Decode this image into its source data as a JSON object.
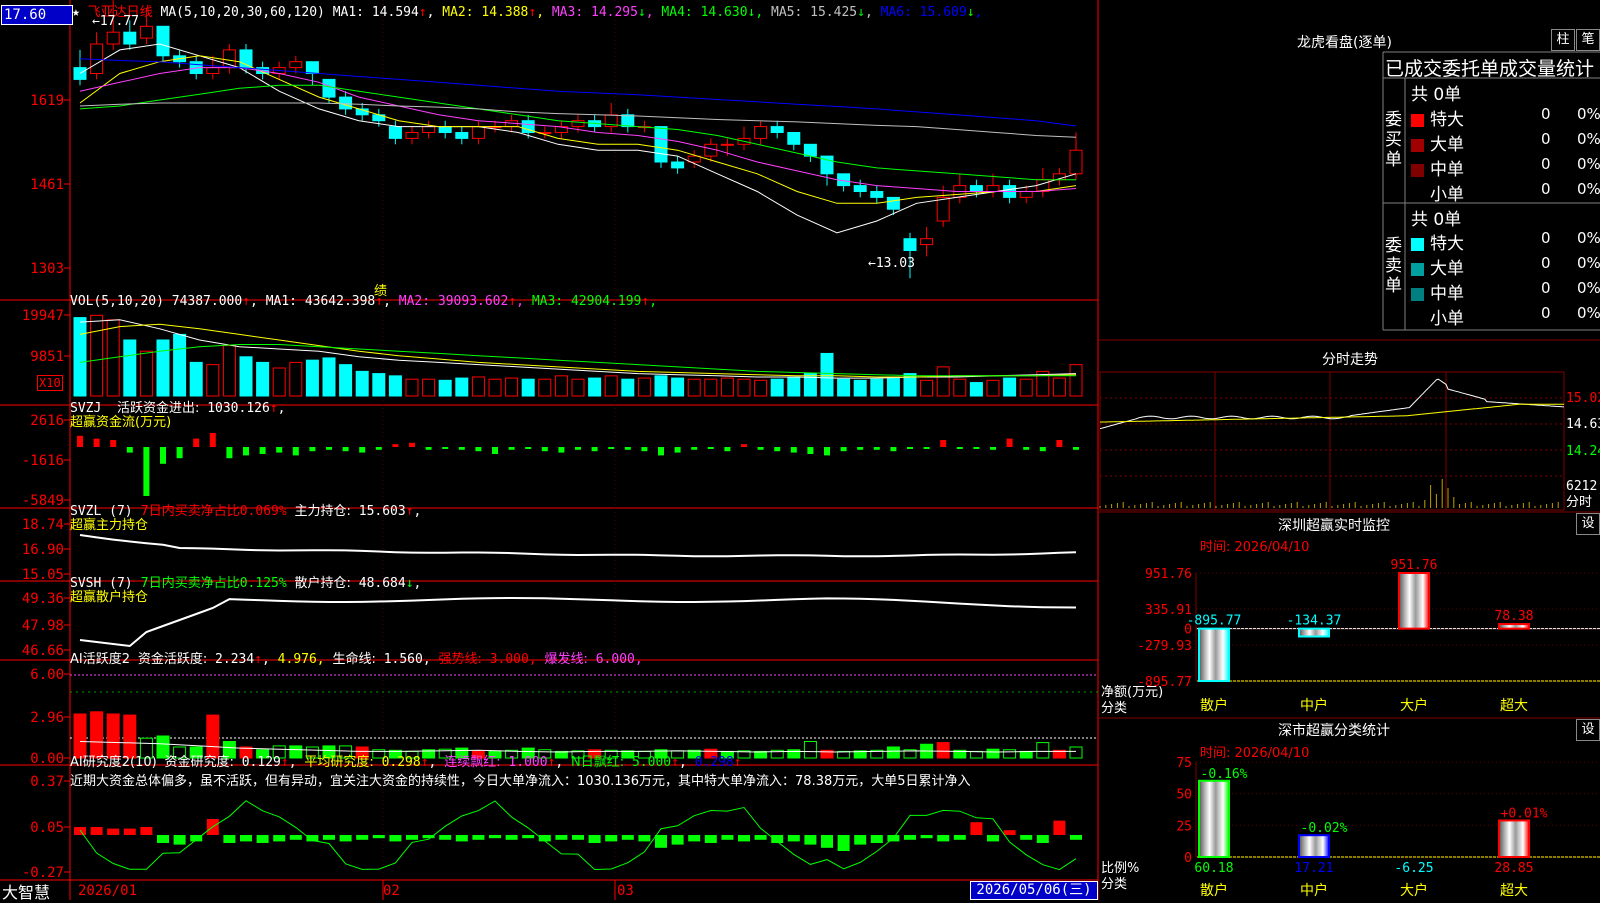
{
  "stock": {
    "title": "飞亚达日线",
    "price_badge": "17.60",
    "ma_header": "MA(5,10,20,30,60,120)",
    "ma_values": [
      {
        "label": "MA1:",
        "value": "14.594",
        "arrow": "↑",
        "color": "#ffffff"
      },
      {
        "label": "MA2:",
        "value": "14.388",
        "arrow": "↑",
        "color": "#ffff00"
      },
      {
        "label": "MA3:",
        "value": "14.295",
        "arrow": "↓",
        "color": "#ff40ff"
      },
      {
        "label": "MA4:",
        "value": "14.630",
        "arrow": "↓",
        "color": "#00ff00"
      },
      {
        "label": "MA5:",
        "value": "15.425",
        "arrow": "↓",
        "color": "#c0c0c0"
      },
      {
        "label": "MA6:",
        "value": "15.609",
        "arrow": "↓",
        "color": "#0000ff"
      }
    ],
    "high_label": "17.77",
    "low_label": "13.03",
    "event_marker": "绩",
    "y_ticks": [
      "1619",
      "1461",
      "1303"
    ],
    "x_ticks": [
      "2026/01",
      "02",
      "03"
    ],
    "current_date": "2026/05/06(三)",
    "brand": "大智慧"
  },
  "vol": {
    "header": "VOL(5,10,20)",
    "value": "74387.000",
    "ma": [
      {
        "label": "MA1:",
        "value": "43642.398",
        "color": "#ffffff"
      },
      {
        "label": "MA2:",
        "value": "39093.602",
        "color": "#ff40ff"
      },
      {
        "label": "MA3:",
        "value": "42904.199",
        "color": "#00ff00"
      }
    ],
    "y_ticks": [
      "19947",
      "9851"
    ],
    "unit": "X10"
  },
  "svzj": {
    "name": "SVZJ",
    "label": "活跃资金进出:",
    "value": "1030.126",
    "sub": "超赢资金流(万元)",
    "y_ticks": [
      "2616",
      "-1616",
      "-5849"
    ]
  },
  "svzl": {
    "name": "SVZL (7)",
    "label": "7日内买卖净占比",
    "value": "0.069%",
    "label2": "主力持仓:",
    "value2": "15.603",
    "sub": "超赢主力持仓",
    "y_ticks": [
      "18.74",
      "16.90",
      "15.05"
    ]
  },
  "svsh": {
    "name": "SVSH (7)",
    "label": "7日内买卖净占比",
    "value": "0.125%",
    "label2": "散户持仓:",
    "value2": "48.684",
    "sub": "超赢散户持仓",
    "y_ticks": [
      "49.36",
      "47.98",
      "46.66"
    ]
  },
  "ai1": {
    "name": "AI活跃度2",
    "l1": "资金活跃度:",
    "v1": "2.234",
    "v2": "4.976,",
    "l3": "生命线:",
    "v3": "1.560,",
    "l4": "强势线:",
    "v4": "3.000,",
    "l5": "爆发线:",
    "v5": "6.000,",
    "y_ticks": [
      "6.00",
      "2.96",
      "0.00"
    ]
  },
  "ai2": {
    "name": "AI研究度2(10)",
    "l1": "资金研究度:",
    "v1": "0.129",
    "l2": "平均研究度:",
    "v2": "0.298",
    "l3": "连续飘红:",
    "v3": "1.000",
    "l4": "N日飘红:",
    "v4": "5.000",
    "v5": "0.298",
    "comment": "近期大资金总体偏多，虽不活跃，但有异动，宜关注大资金的持续性，今日大单净流入：1030.136万元，其中特大单净流入：78.38万元，大单5日累计净入",
    "y_ticks": [
      "0.37",
      "0.05",
      "-0.27"
    ]
  },
  "longhu": {
    "title": "龙虎看盘(逐单)",
    "btn1": "柱",
    "btn2": "笔",
    "subtitle": "已成交委托单成交量统计",
    "buy_side": "委买单",
    "sell_side": "委卖单",
    "buy_total": "共 0单",
    "sell_total": "共 0单",
    "buy_rows": [
      {
        "name": "特大",
        "count": "0",
        "pct": "0%",
        "color": "#ff0000"
      },
      {
        "name": "大单",
        "count": "0",
        "pct": "0%",
        "color": "#a00000"
      },
      {
        "name": "中单",
        "count": "0",
        "pct": "0%",
        "color": "#800000"
      },
      {
        "name": "小单",
        "count": "0",
        "pct": "0%",
        "color": "#000000"
      }
    ],
    "sell_rows": [
      {
        "name": "特大",
        "count": "0",
        "pct": "0%",
        "color": "#00ffff"
      },
      {
        "name": "大单",
        "count": "0",
        "pct": "0%",
        "color": "#00a0a0"
      },
      {
        "name": "中单",
        "count": "0",
        "pct": "0%",
        "color": "#008080"
      },
      {
        "name": "小单",
        "count": "0",
        "pct": "0%",
        "color": "#000000"
      }
    ]
  },
  "fenshi": {
    "title": "分时走势",
    "y_ticks": [
      "15.02",
      "14.63",
      "14.24"
    ],
    "vol_label": "6212",
    "vol_unit": "分时"
  },
  "monitor": {
    "title": "深圳超赢实时监控",
    "btn": "设",
    "time": "时间: 2026/04/10",
    "y_ticks": [
      "951.76",
      "335.91",
      "0",
      "-279.93",
      "-895.77"
    ],
    "ylabel1": "净额(万元)",
    "ylabel2": "分类"
  },
  "classify": {
    "title": "深市超赢分类统计",
    "btn": "设",
    "time": "时间: 2026/04/10",
    "y_ticks": [
      "75",
      "50",
      "25",
      "0"
    ],
    "ylabel1": "比例%",
    "ylabel2": "分类"
  },
  "chart_data": [
    {
      "type": "bar",
      "title": "深圳超赢实时监控",
      "ylabel": "净额(万元)",
      "xlabel": "分类",
      "categories": [
        "散户",
        "中户",
        "大户",
        "超大"
      ],
      "values": [
        -895.77,
        -134.37,
        951.76,
        78.38
      ],
      "value_labels": [
        "-895.77",
        "-134.37",
        "951.76",
        "78.38"
      ],
      "ylim": [
        -895.77,
        951.76
      ]
    },
    {
      "type": "bar",
      "title": "深市超赢分类统计",
      "ylabel": "比例%",
      "xlabel": "分类",
      "categories": [
        "散户",
        "中户",
        "大户",
        "超大"
      ],
      "values": [
        60.18,
        17.21,
        -6.25,
        28.85
      ],
      "changes": [
        "-0.16%",
        "-0.02%",
        "",
        "+0.01%"
      ],
      "value_labels": [
        "60.18",
        "17.21",
        "-6.25",
        "28.85"
      ],
      "ylim": [
        0,
        75
      ]
    }
  ]
}
